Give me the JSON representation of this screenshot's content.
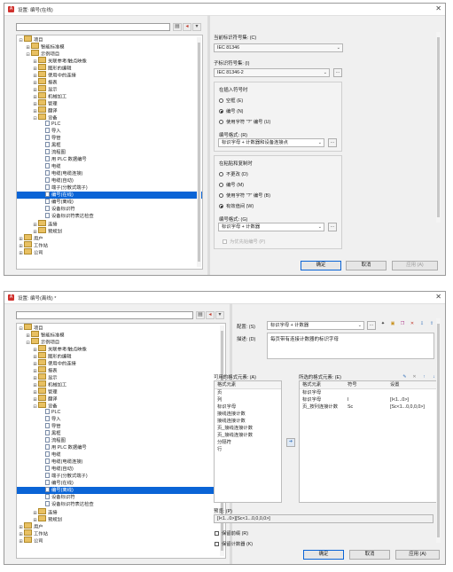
{
  "window1": {
    "title": "设置: 编号(在线)",
    "tree": [
      {
        "label": "项目",
        "level": 0,
        "icon": "folder",
        "exp": "−"
      },
      {
        "label": "智能标准模",
        "level": 1,
        "icon": "folder",
        "exp": "+"
      },
      {
        "label": "示例项目",
        "level": 1,
        "icon": "folder",
        "exp": "−"
      },
      {
        "label": "关联参考/触点映像",
        "level": 2,
        "icon": "folder",
        "exp": "+"
      },
      {
        "label": "图形的编辑",
        "level": 2,
        "icon": "folder",
        "exp": "+"
      },
      {
        "label": "使用中的连接",
        "level": 2,
        "icon": "folder",
        "exp": "+"
      },
      {
        "label": "报表",
        "level": 2,
        "icon": "folder",
        "exp": "+"
      },
      {
        "label": "显示",
        "level": 2,
        "icon": "folder",
        "exp": "+"
      },
      {
        "label": "机械加工",
        "level": 2,
        "icon": "folder",
        "exp": "+"
      },
      {
        "label": "管理",
        "level": 2,
        "icon": "folder",
        "exp": "+"
      },
      {
        "label": "翻译",
        "level": 2,
        "icon": "folder",
        "exp": "+"
      },
      {
        "label": "设备",
        "level": 2,
        "icon": "folder",
        "exp": "−"
      },
      {
        "label": "PLC",
        "level": 3,
        "icon": "doc",
        "exp": ""
      },
      {
        "label": "导入",
        "level": 3,
        "icon": "doc",
        "exp": ""
      },
      {
        "label": "导管",
        "level": 3,
        "icon": "doc",
        "exp": ""
      },
      {
        "label": "黑框",
        "level": 3,
        "icon": "doc",
        "exp": ""
      },
      {
        "label": "流程图",
        "level": 3,
        "icon": "doc",
        "exp": ""
      },
      {
        "label": "用 PLC 数据编号",
        "level": 3,
        "icon": "doc",
        "exp": ""
      },
      {
        "label": "电缆",
        "level": 3,
        "icon": "doc",
        "exp": ""
      },
      {
        "label": "电缆(电缆连接)",
        "level": 3,
        "icon": "doc",
        "exp": ""
      },
      {
        "label": "电缆(自动)",
        "level": 3,
        "icon": "doc",
        "exp": ""
      },
      {
        "label": "端子(分散式端子)",
        "level": 3,
        "icon": "doc",
        "exp": ""
      },
      {
        "label": "编号(在线)",
        "level": 3,
        "icon": "doc",
        "exp": "",
        "selected": true
      },
      {
        "label": "编号(离线)",
        "level": 3,
        "icon": "doc",
        "exp": ""
      },
      {
        "label": "设备标识符",
        "level": 3,
        "icon": "doc",
        "exp": ""
      },
      {
        "label": "设备标识符表达检查",
        "level": 3,
        "icon": "doc",
        "exp": ""
      },
      {
        "label": "连接",
        "level": 2,
        "icon": "folder",
        "exp": "+"
      },
      {
        "label": "预规划",
        "level": 2,
        "icon": "folder",
        "exp": "+"
      },
      {
        "label": "用户",
        "level": 0,
        "icon": "folder",
        "exp": "+"
      },
      {
        "label": "工作站",
        "level": 0,
        "icon": "folder",
        "exp": "+"
      },
      {
        "label": "公司",
        "level": 0,
        "icon": "folder",
        "exp": "+"
      }
    ],
    "current_std_label": "当前标识符号集: (C)",
    "current_std_value": "IEC 81346",
    "sub_std_label": "子标识符号集: (I)",
    "sub_std_value": "IEC 81346-2",
    "insert_group_title": "在插入符号时",
    "insert_options": [
      "空框 (E)",
      "编号 (N)",
      "使用字符 \"?\" 编号 (U)"
    ],
    "insert_selected": 1,
    "insert_format_label": "编号格式: (R)",
    "insert_format_value": "标识字母 + 计数器和设备连接点",
    "copy_group_title": "在粘贴和复制时",
    "copy_options": [
      "不更改 (D)",
      "编号 (M)",
      "使用字符 \"?\" 编号 (B)",
      "有效值间 (W)"
    ],
    "copy_selected": 3,
    "copy_format_label": "编号格式: (G)",
    "copy_format_value": "标识字母 + 计数器",
    "copy_checkbox": "为优先始编号 (P)",
    "ok": "确定",
    "cancel": "取消",
    "apply": "应用 (A)"
  },
  "window2": {
    "title": "设置: 编号(离线) *",
    "tree": [
      {
        "label": "项目",
        "level": 0,
        "icon": "folder",
        "exp": "−"
      },
      {
        "label": "智能标准模",
        "level": 1,
        "icon": "folder",
        "exp": "+"
      },
      {
        "label": "示例项目",
        "level": 1,
        "icon": "folder",
        "exp": "−"
      },
      {
        "label": "关联参考/触点映像",
        "level": 2,
        "icon": "folder",
        "exp": "+"
      },
      {
        "label": "图形的编辑",
        "level": 2,
        "icon": "folder",
        "exp": "+"
      },
      {
        "label": "使用中的连接",
        "level": 2,
        "icon": "folder",
        "exp": "+"
      },
      {
        "label": "报表",
        "level": 2,
        "icon": "folder",
        "exp": "+"
      },
      {
        "label": "显示",
        "level": 2,
        "icon": "folder",
        "exp": "+"
      },
      {
        "label": "机械加工",
        "level": 2,
        "icon": "folder",
        "exp": "+"
      },
      {
        "label": "管理",
        "level": 2,
        "icon": "folder",
        "exp": "+"
      },
      {
        "label": "翻译",
        "level": 2,
        "icon": "folder",
        "exp": "+"
      },
      {
        "label": "设备",
        "level": 2,
        "icon": "folder",
        "exp": "−"
      },
      {
        "label": "PLC",
        "level": 3,
        "icon": "doc",
        "exp": ""
      },
      {
        "label": "导入",
        "level": 3,
        "icon": "doc",
        "exp": ""
      },
      {
        "label": "导管",
        "level": 3,
        "icon": "doc",
        "exp": ""
      },
      {
        "label": "黑框",
        "level": 3,
        "icon": "doc",
        "exp": ""
      },
      {
        "label": "流程图",
        "level": 3,
        "icon": "doc",
        "exp": ""
      },
      {
        "label": "用 PLC 数据编号",
        "level": 3,
        "icon": "doc",
        "exp": ""
      },
      {
        "label": "电缆",
        "level": 3,
        "icon": "doc",
        "exp": ""
      },
      {
        "label": "电缆(电缆连接)",
        "level": 3,
        "icon": "doc",
        "exp": ""
      },
      {
        "label": "电缆(自动)",
        "level": 3,
        "icon": "doc",
        "exp": ""
      },
      {
        "label": "端子(分散式端子)",
        "level": 3,
        "icon": "doc",
        "exp": ""
      },
      {
        "label": "编号(在线)",
        "level": 3,
        "icon": "doc",
        "exp": ""
      },
      {
        "label": "编号(离线)",
        "level": 3,
        "icon": "doc",
        "exp": "",
        "selected": true
      },
      {
        "label": "设备标识符",
        "level": 3,
        "icon": "doc",
        "exp": ""
      },
      {
        "label": "设备标识符表达检查",
        "level": 3,
        "icon": "doc",
        "exp": ""
      },
      {
        "label": "连接",
        "level": 2,
        "icon": "folder",
        "exp": "+"
      },
      {
        "label": "预规划",
        "level": 2,
        "icon": "folder",
        "exp": "+"
      },
      {
        "label": "用户",
        "level": 0,
        "icon": "folder",
        "exp": "+"
      },
      {
        "label": "工作站",
        "level": 0,
        "icon": "folder",
        "exp": "+"
      },
      {
        "label": "公司",
        "level": 0,
        "icon": "folder",
        "exp": "+"
      }
    ],
    "config_label": "配置: (S)",
    "config_value": "标识字母 + 计数器",
    "desc_label": "描述: (D)",
    "desc_value": "每页带有连接计数器的标识字母",
    "available_label": "可用的格式元素: (A)",
    "available_header": "格式元素",
    "available_items": [
      "页",
      "列",
      "标识字母",
      "接线连接计数",
      "接线连接计数",
      "页_接线连接计数",
      "页_接线连接计数",
      "分隔符",
      "行"
    ],
    "selected_label": "所选的格式元素: (E)",
    "selected_headers": [
      "格式元素",
      "符号",
      "设置"
    ],
    "selected_rows": [
      [
        "标识字母",
        "",
        ""
      ],
      [
        "标识字母",
        "I",
        "[I<1...0>]"
      ],
      [
        "页_按列连接计数",
        "Sc",
        "[Sc<1...0,0,0,0>]"
      ]
    ],
    "preview_label": "预览: (P)",
    "preview_value": "[I<1...0>][Sc<1...0,0,0,0>]",
    "checkbox1": "保留前缀 (R)",
    "checkbox2": "保留计数器 (K)",
    "ok": "确定",
    "cancel": "取消",
    "apply": "应用 (A)"
  }
}
